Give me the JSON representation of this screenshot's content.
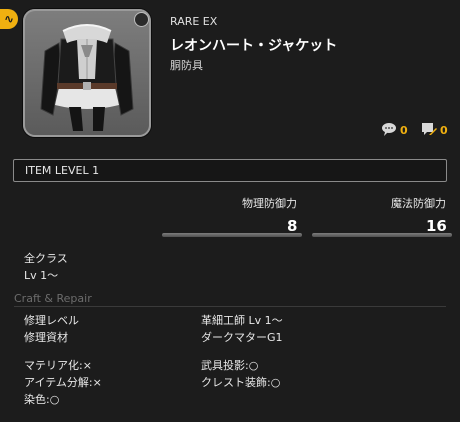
{
  "header": {
    "badge_glyph": "∿",
    "rarity": "RARE EX",
    "name": "レオンハート・ジャケット",
    "type": "胴防具"
  },
  "counters": [
    {
      "icon": "speech-bubble-icon",
      "value": "0"
    },
    {
      "icon": "comment-edit-icon",
      "value": "0"
    }
  ],
  "item_level": "ITEM LEVEL 1",
  "stats": [
    {
      "label": "物理防御力",
      "value": "8"
    },
    {
      "label": "魔法防御力",
      "value": "16"
    }
  ],
  "requirements": {
    "classes": "全クラス",
    "level": "Lv 1〜"
  },
  "craft_repair": {
    "title": "Craft & Repair",
    "repair_level_label": "修理レベル",
    "repair_level_value": "革細工師 Lv 1〜",
    "repair_material_label": "修理資材",
    "repair_material_value": "ダークマターG1"
  },
  "properties": {
    "materia": "マテリア化:×",
    "desynth": "アイテム分解:×",
    "dye": "染色:○",
    "projection": "武具投影:○",
    "crest": "クレスト装飾:○"
  },
  "colors": {
    "accent": "#f0b010",
    "background": "#1c1c1c"
  }
}
